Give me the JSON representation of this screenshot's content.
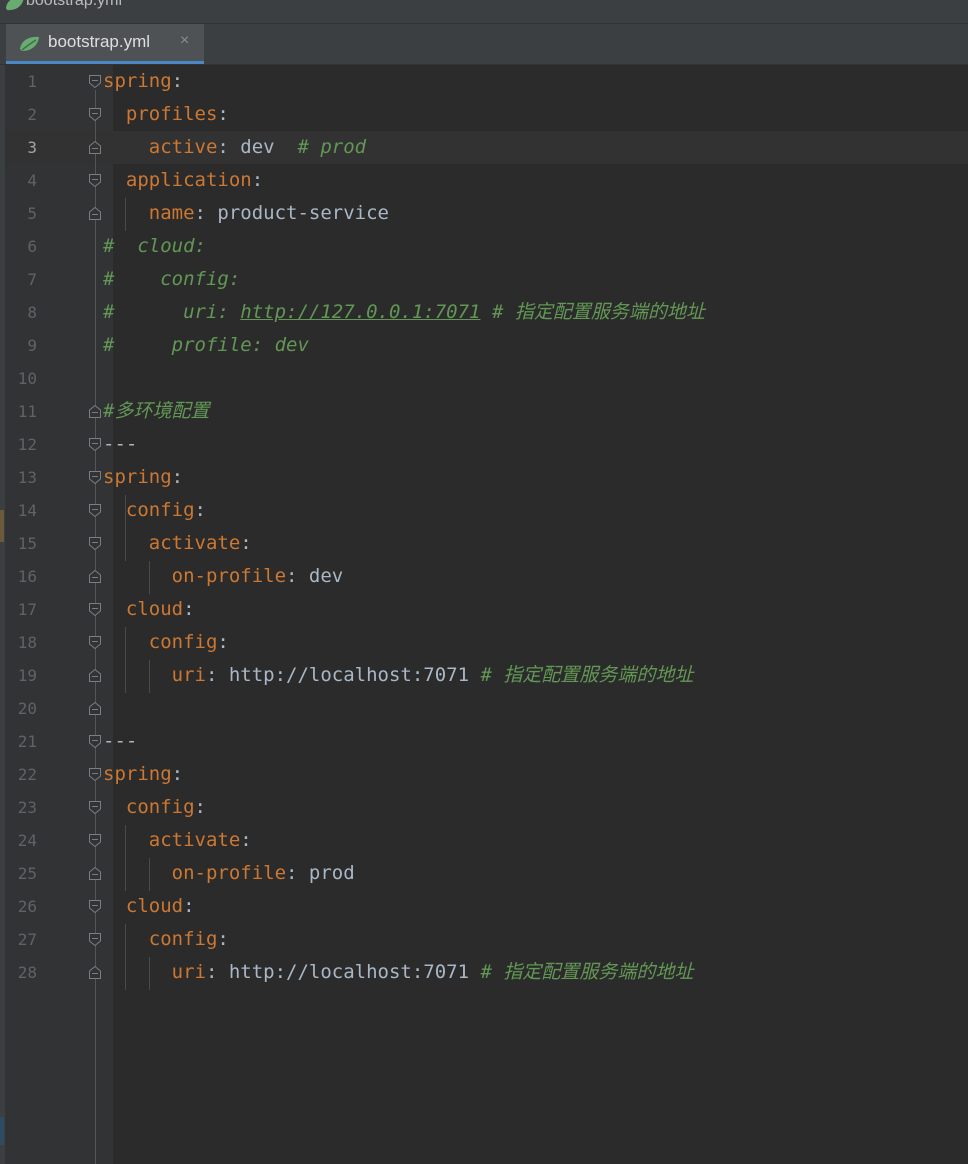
{
  "window": {
    "title": "bootstrap.yml"
  },
  "tabs": [
    {
      "label": "bootstrap.yml",
      "close": "×",
      "active": true
    }
  ],
  "editor": {
    "current_line": 3,
    "lines": [
      {
        "n": "1",
        "fold": "open",
        "segs": [
          {
            "t": "spring",
            "s": "k"
          },
          {
            "t": ":",
            "s": "v"
          }
        ]
      },
      {
        "n": "2",
        "fold": "open",
        "segs": [
          {
            "t": "  profiles",
            "s": "k"
          },
          {
            "t": ":",
            "s": "v"
          }
        ]
      },
      {
        "n": "3",
        "fold": "end",
        "segs": [
          {
            "t": "    active",
            "s": "k"
          },
          {
            "t": ": dev  ",
            "s": "v"
          },
          {
            "t": "# prod",
            "s": "c"
          }
        ]
      },
      {
        "n": "4",
        "fold": "open",
        "segs": [
          {
            "t": "  application",
            "s": "k"
          },
          {
            "t": ":",
            "s": "v"
          }
        ]
      },
      {
        "n": "5",
        "fold": "end",
        "segs": [
          {
            "t": "    name",
            "s": "k"
          },
          {
            "t": ": product-service",
            "s": "v"
          }
        ]
      },
      {
        "n": "6",
        "fold": "",
        "segs": [
          {
            "t": "#  cloud:",
            "s": "c"
          }
        ]
      },
      {
        "n": "7",
        "fold": "",
        "segs": [
          {
            "t": "#    config:",
            "s": "c"
          }
        ]
      },
      {
        "n": "8",
        "fold": "",
        "segs": [
          {
            "t": "#      uri: ",
            "s": "c"
          },
          {
            "t": "http://127.0.0.1:7071",
            "s": "c u"
          },
          {
            "t": " # 指定配置服务端的地址",
            "s": "c"
          }
        ]
      },
      {
        "n": "9",
        "fold": "",
        "segs": [
          {
            "t": "#     profile: dev",
            "s": "c"
          }
        ]
      },
      {
        "n": "10",
        "fold": "",
        "segs": []
      },
      {
        "n": "11",
        "fold": "end",
        "segs": [
          {
            "t": "#多环境配置",
            "s": "c"
          }
        ]
      },
      {
        "n": "12",
        "fold": "open",
        "segs": [
          {
            "t": "---",
            "s": "v"
          }
        ]
      },
      {
        "n": "13",
        "fold": "open",
        "segs": [
          {
            "t": "spring",
            "s": "k"
          },
          {
            "t": ":",
            "s": "v"
          }
        ]
      },
      {
        "n": "14",
        "fold": "open",
        "segs": [
          {
            "t": "  config",
            "s": "k"
          },
          {
            "t": ":",
            "s": "v"
          }
        ]
      },
      {
        "n": "15",
        "fold": "open",
        "segs": [
          {
            "t": "    activate",
            "s": "k"
          },
          {
            "t": ":",
            "s": "v"
          }
        ]
      },
      {
        "n": "16",
        "fold": "end",
        "segs": [
          {
            "t": "      on-profile",
            "s": "k"
          },
          {
            "t": ": dev",
            "s": "v"
          }
        ]
      },
      {
        "n": "17",
        "fold": "open",
        "segs": [
          {
            "t": "  cloud",
            "s": "k"
          },
          {
            "t": ":",
            "s": "v"
          }
        ]
      },
      {
        "n": "18",
        "fold": "open",
        "segs": [
          {
            "t": "    config",
            "s": "k"
          },
          {
            "t": ":",
            "s": "v"
          }
        ]
      },
      {
        "n": "19",
        "fold": "end",
        "segs": [
          {
            "t": "      uri",
            "s": "k"
          },
          {
            "t": ": http://localhost:7071 ",
            "s": "v"
          },
          {
            "t": "# 指定配置服务端的地址",
            "s": "c"
          }
        ]
      },
      {
        "n": "20",
        "fold": "end",
        "segs": []
      },
      {
        "n": "21",
        "fold": "open",
        "segs": [
          {
            "t": "---",
            "s": "v"
          }
        ]
      },
      {
        "n": "22",
        "fold": "open",
        "segs": [
          {
            "t": "spring",
            "s": "k"
          },
          {
            "t": ":",
            "s": "v"
          }
        ]
      },
      {
        "n": "23",
        "fold": "open",
        "segs": [
          {
            "t": "  config",
            "s": "k"
          },
          {
            "t": ":",
            "s": "v"
          }
        ]
      },
      {
        "n": "24",
        "fold": "open",
        "segs": [
          {
            "t": "    activate",
            "s": "k"
          },
          {
            "t": ":",
            "s": "v"
          }
        ]
      },
      {
        "n": "25",
        "fold": "end",
        "segs": [
          {
            "t": "      on-profile",
            "s": "k"
          },
          {
            "t": ": prod",
            "s": "v"
          }
        ]
      },
      {
        "n": "26",
        "fold": "open",
        "segs": [
          {
            "t": "  cloud",
            "s": "k"
          },
          {
            "t": ":",
            "s": "v"
          }
        ]
      },
      {
        "n": "27",
        "fold": "open",
        "segs": [
          {
            "t": "    config",
            "s": "k"
          },
          {
            "t": ":",
            "s": "v"
          }
        ]
      },
      {
        "n": "28",
        "fold": "end",
        "segs": [
          {
            "t": "      uri",
            "s": "k"
          },
          {
            "t": ": http://localhost:7071 ",
            "s": "v"
          },
          {
            "t": "# 指定配置服务端的地址",
            "s": "c"
          }
        ]
      }
    ]
  },
  "colors": {
    "background": "#2b2b2b",
    "keyword": "#cc7832",
    "text": "#a9b7c6",
    "comment": "#629755",
    "tab_underline": "#4a88c7"
  },
  "icons": {
    "file_icon": "spring-leaf-icon",
    "fold_open": "fold-open-icon",
    "fold_end": "fold-end-icon"
  }
}
